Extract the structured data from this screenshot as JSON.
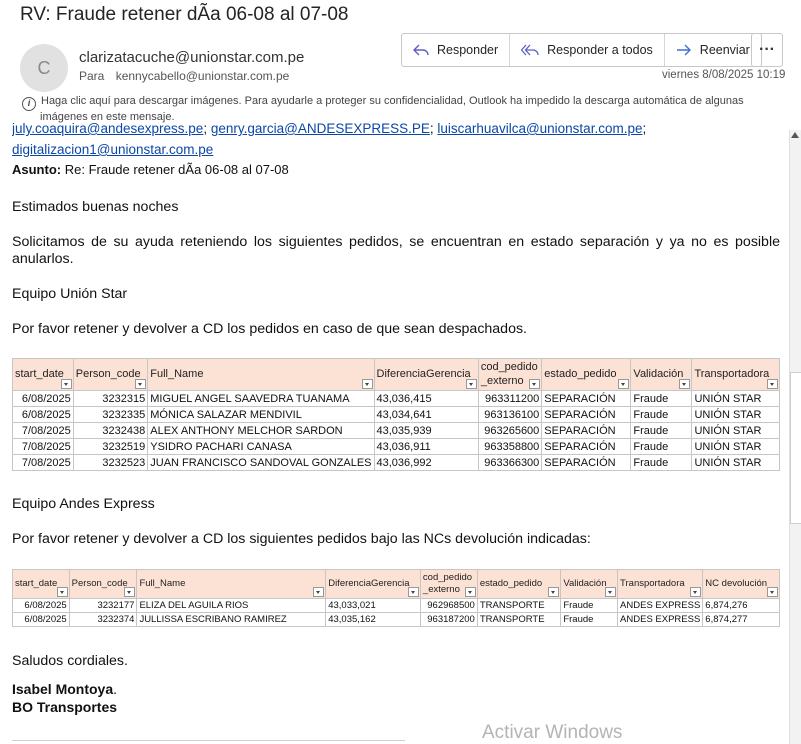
{
  "email": {
    "subject": "RV: Fraude retener dÃa 06-08 al 07-08",
    "avatar_initial": "C",
    "from": "clarizatacuche@unionstar.com.pe",
    "to_label": "Para",
    "to": "kennycabello@unionstar.com.pe",
    "date": "viernes 8/08/2025 10:19",
    "actions": {
      "reply": "Responder",
      "reply_all": "Responder a todos",
      "forward": "Reenviar",
      "more": "···"
    },
    "info_line1": "Haga clic aquí para descargar imágenes. Para ayudarle a proteger su confidencialidad, Outlook ha impedido la descarga automática de algunas",
    "info_line2": "imágenes en este mensaje."
  },
  "body": {
    "cc_links": [
      "july.coaquira@andesexpress.pe",
      "genry.garcia@ANDESEXPRESS.PE",
      "luiscarhuavilca@unionstar.com.pe"
    ],
    "cc_sep": "; ",
    "cc_trail": ";",
    "cc_link4": "digitalizacion1@unionstar.com.pe",
    "asunto_label": "Asunto:",
    "asunto_text": " Re: Fraude retener dÃa 06-08 al 07-08",
    "greeting": "Estimados buenas noches",
    "request": "Solicitamos de su ayuda reteniendo los siguientes pedidos, se encuentran en estado separación y ya no es posible anularlos.",
    "team1": "Equipo Unión Star",
    "instr1": "Por favor retener y devolver a CD los pedidos en caso de que sean despachados.",
    "team2": "Equipo Andes Express",
    "instr2": "Por favor retener y devolver a CD los siguientes pedidos bajo las NCs devolución indicadas:",
    "closing": "Saludos cordiales.",
    "sig_name": "Isabel Montoya",
    "sig_dot": ".",
    "sig_dept": "BO Transportes",
    "watermark": "Activar Windows"
  },
  "table1": {
    "headers": [
      "start_date",
      "Person_code",
      "Full_Name",
      "DiferenciaGerencia",
      "cod_pedido\n_externo",
      "estado_pedido",
      "Validación",
      "Transportadora"
    ],
    "rows": [
      [
        "6/08/2025",
        "3232315",
        "MIGUEL ANGEL SAAVEDRA TUANAMA",
        "43,036,415",
        "963311200",
        "SEPARACIÓN",
        "Fraude",
        "UNIÓN STAR"
      ],
      [
        "6/08/2025",
        "3232335",
        "MÓNICA SALAZAR MENDIVIL",
        "43,034,641",
        "963136100",
        "SEPARACIÓN",
        "Fraude",
        "UNIÓN STAR"
      ],
      [
        "7/08/2025",
        "3232438",
        "ALEX ANTHONY MELCHOR SARDON",
        "43,035,939",
        "963265600",
        "SEPARACIÓN",
        "Fraude",
        "UNIÓN STAR"
      ],
      [
        "7/08/2025",
        "3232519",
        "YSIDRO PACHARI CANASA",
        "43,036,911",
        "963358800",
        "SEPARACIÓN",
        "Fraude",
        "UNIÓN STAR"
      ],
      [
        "7/08/2025",
        "3232523",
        "JUAN FRANCISCO SANDOVAL GONZALES",
        "43,036,992",
        "963366300",
        "SEPARACIÓN",
        "Fraude",
        "UNIÓN STAR"
      ]
    ]
  },
  "table2": {
    "headers": [
      "start_date",
      "Person_code",
      "Full_Name",
      "DiferenciaGerencia",
      "cod_pedido\n_externo",
      "estado_pedido",
      "Validación",
      "Transportadora",
      "NC devolución"
    ],
    "rows": [
      [
        "6/08/2025",
        "3232177",
        "ELIZA DEL AGUILA RIOS",
        "43,033,021",
        "962968500",
        "TRANSPORTE",
        "Fraude",
        "ANDES EXPRESS",
        "6,874,276"
      ],
      [
        "6/08/2025",
        "3232374",
        "JULLISSA ESCRIBANO RAMIREZ",
        "43,035,162",
        "963187200",
        "TRANSPORTE",
        "Fraude",
        "ANDES EXPRESS",
        "6,874,277"
      ]
    ]
  }
}
